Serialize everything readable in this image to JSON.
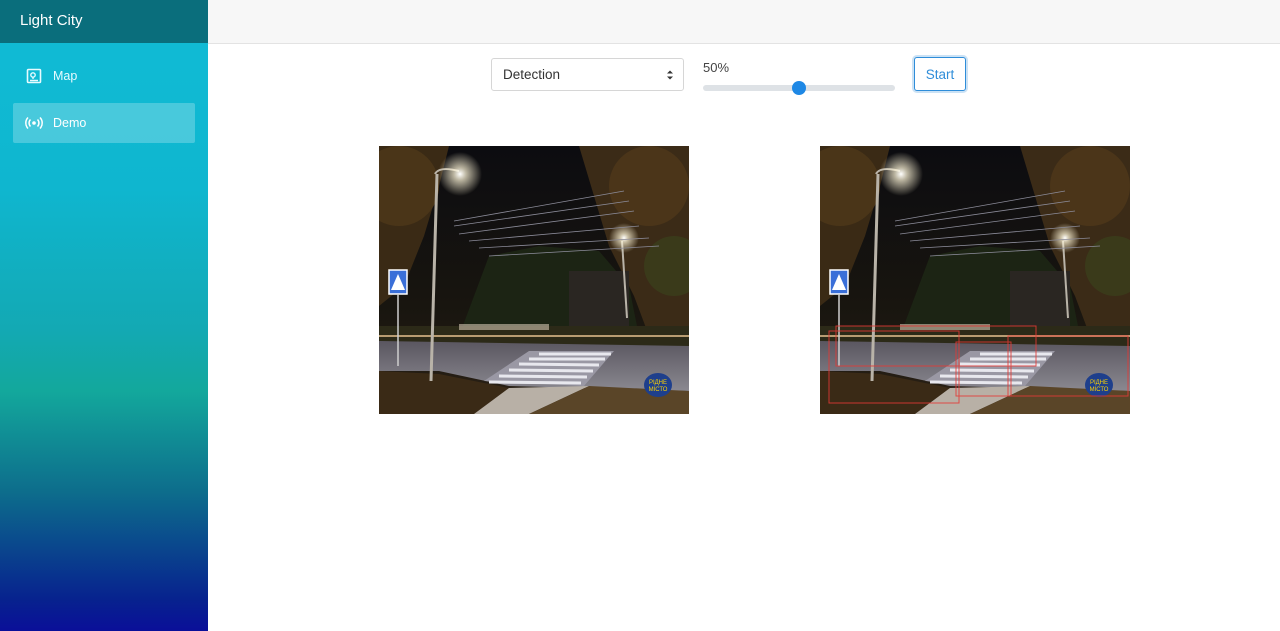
{
  "app": {
    "title": "Light City"
  },
  "sidebar": {
    "items": [
      {
        "label": "Map",
        "icon": "map-icon",
        "active": false
      },
      {
        "label": "Demo",
        "icon": "broadcast-icon",
        "active": true
      }
    ]
  },
  "controls": {
    "mode_select": {
      "value": "Detection"
    },
    "threshold": {
      "label": "50%",
      "value": 0.5
    },
    "start_label": "Start"
  },
  "images": {
    "left": {
      "alt": "Night street with crosswalk and lamps"
    },
    "right": {
      "alt": "Detection result with bounding boxes"
    },
    "watermark_text": [
      "РІДНЕ",
      "МІСТО"
    ]
  },
  "colors": {
    "accent": "#1e88e5",
    "box": "#e53935"
  }
}
